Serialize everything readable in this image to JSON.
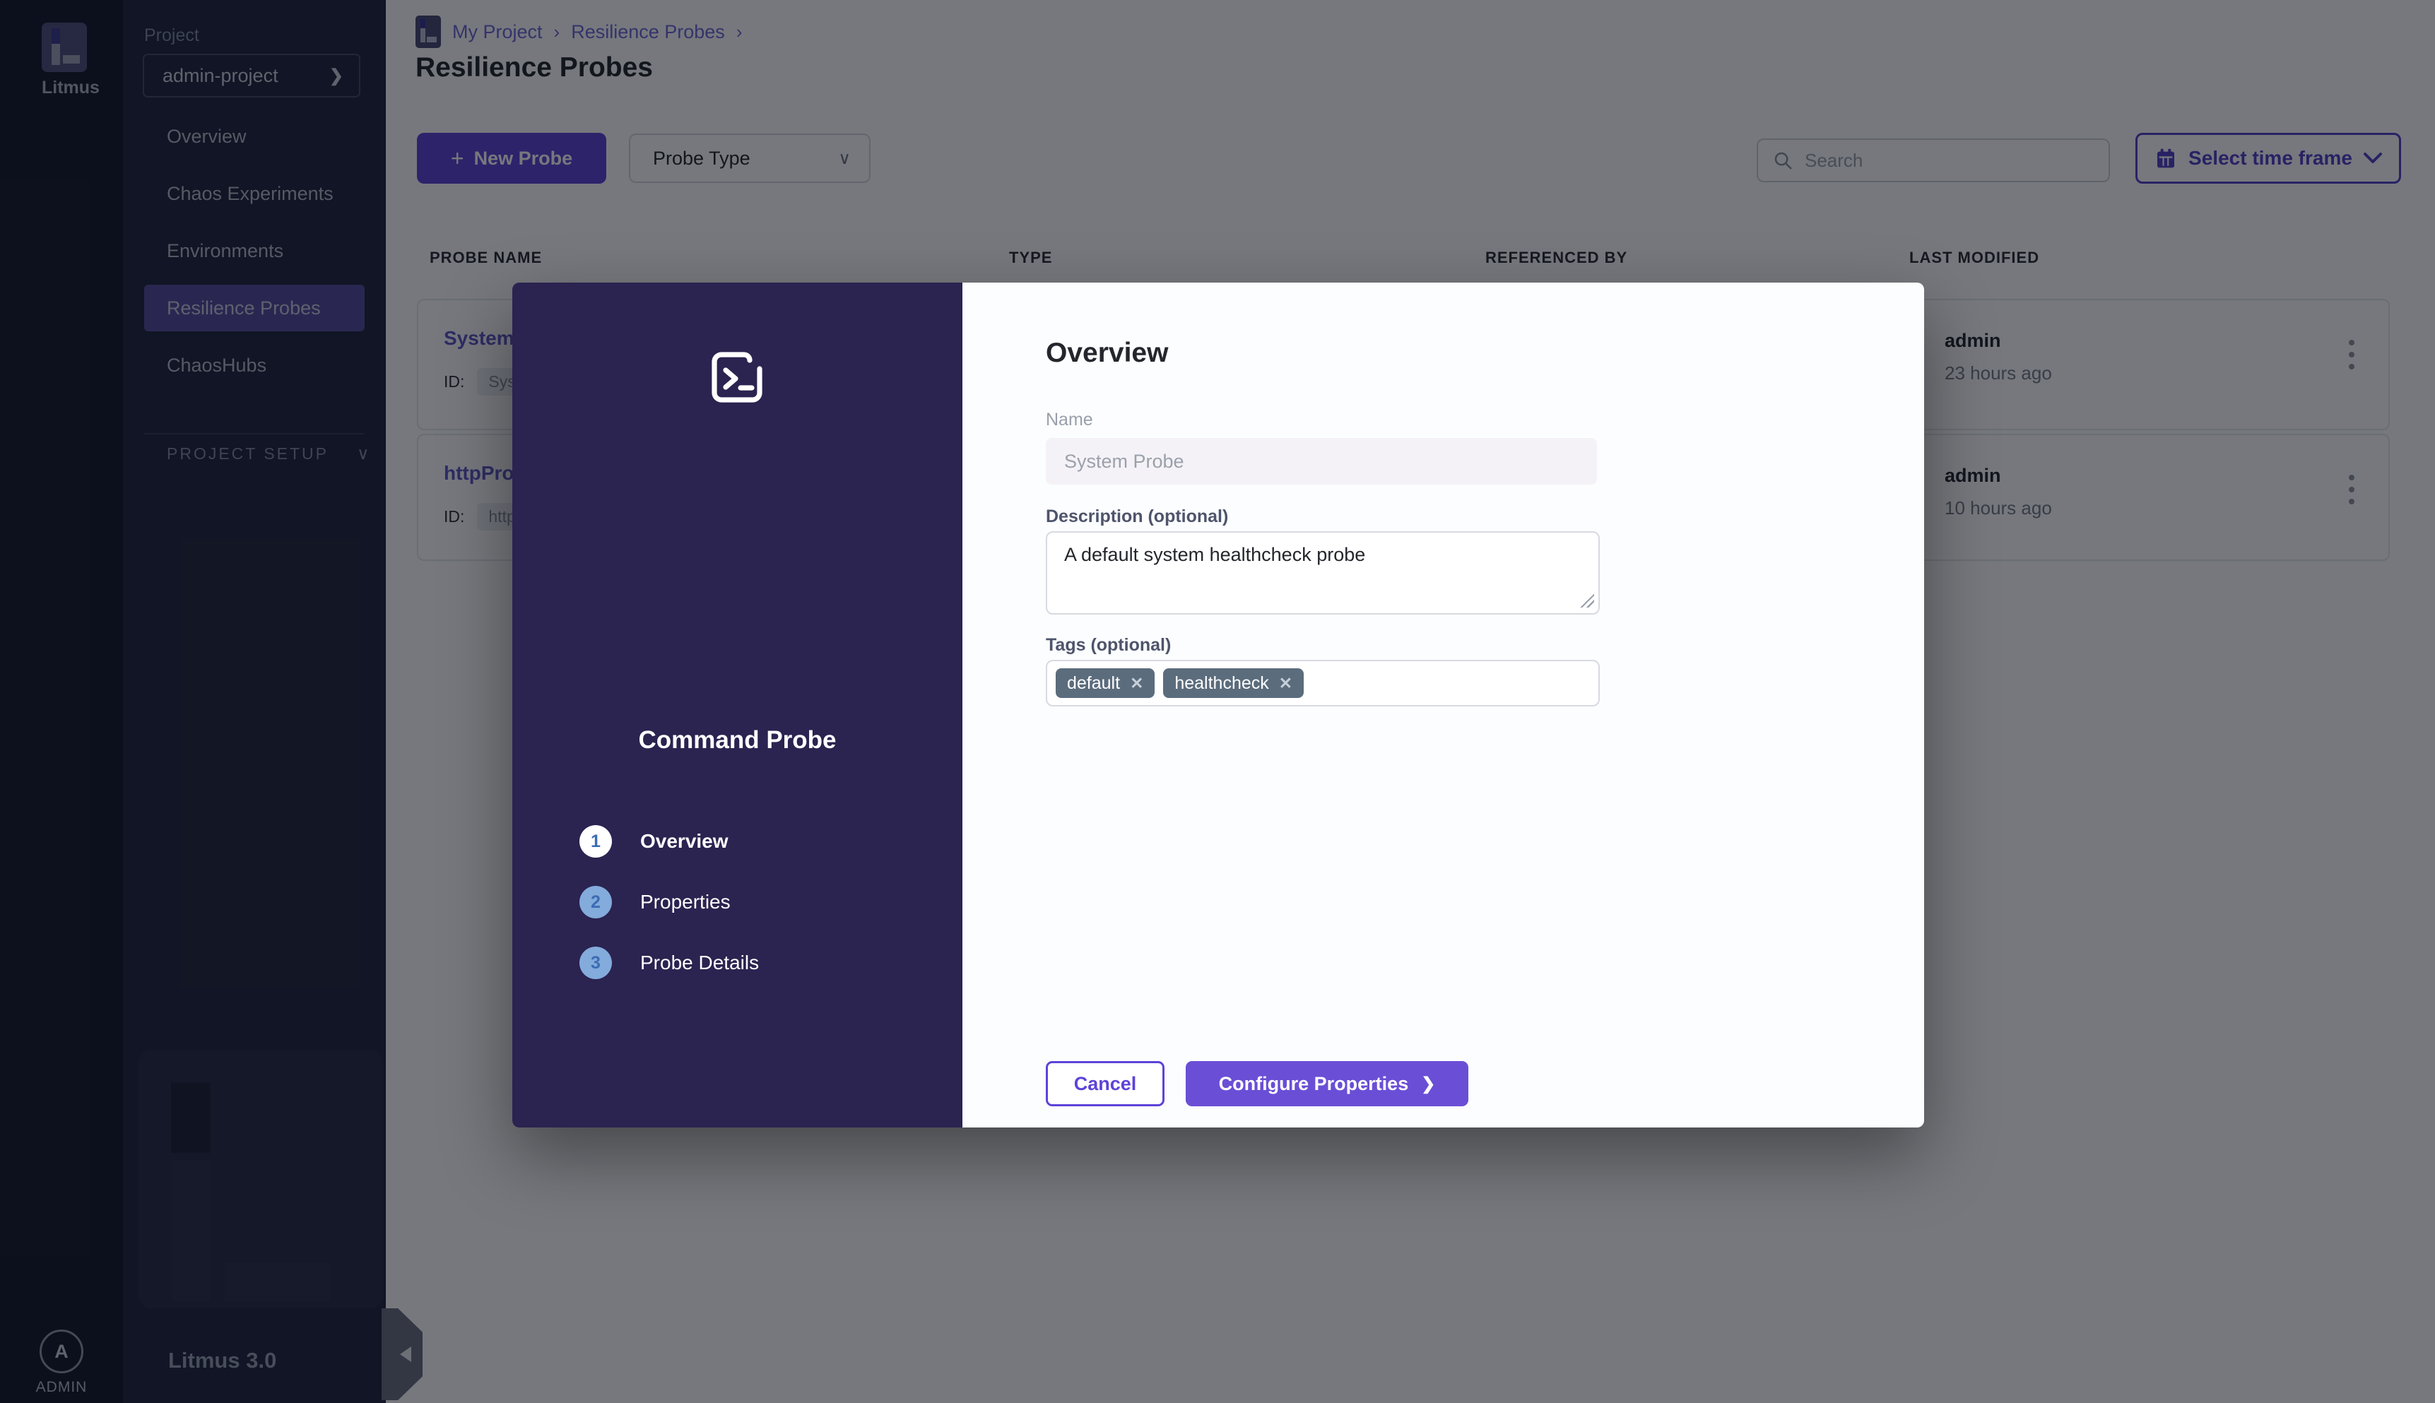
{
  "colors": {
    "primary_purple": "#5d43d8",
    "modal_button_purple": "#6a4ed6",
    "wizard_panel": "#2b2350",
    "sidebar_bg": "#20253c",
    "rail_bg": "#161a2c",
    "active_nav_bg": "#554c9e",
    "link_purple": "#6f66d8",
    "chip_slate": "#5b6c7d"
  },
  "icons": {
    "plus": "+",
    "chevron_right": "❯",
    "chevron_down": "∨",
    "breadcrumb_sep": "›",
    "close": "✕"
  },
  "rail": {
    "logo_text": "Litmus",
    "avatar_letter": "A",
    "admin_label": "ADMIN"
  },
  "sidebar": {
    "project_label": "Project",
    "project_value": "admin-project",
    "items": [
      {
        "label": "Overview"
      },
      {
        "label": "Chaos Experiments"
      },
      {
        "label": "Environments"
      },
      {
        "label": "Resilience Probes"
      },
      {
        "label": "ChaosHubs"
      }
    ],
    "project_setup_label": "PROJECT SETUP",
    "version": "Litmus 3.0"
  },
  "header": {
    "breadcrumb": [
      "My Project",
      "Resilience Probes"
    ],
    "title": "Resilience Probes"
  },
  "toolbar": {
    "new_probe_label": "New Probe",
    "probe_type_label": "Probe Type",
    "search_placeholder": "Search",
    "time_frame_label": "Select time frame"
  },
  "table": {
    "headers": [
      "PROBE NAME",
      "TYPE",
      "REFERENCED BY",
      "LAST MODIFIED"
    ],
    "rows": [
      {
        "name": "System",
        "id_label": "ID:",
        "id_value": "Syst",
        "modified_by": "admin",
        "last_modified": "23 hours ago"
      },
      {
        "name": "httpPro",
        "id_label": "ID:",
        "id_value": "http",
        "modified_by": "admin",
        "last_modified": "10 hours ago"
      }
    ]
  },
  "modal": {
    "wizard_title": "Command Probe",
    "steps": [
      {
        "number": "1",
        "label": "Overview"
      },
      {
        "number": "2",
        "label": "Properties"
      },
      {
        "number": "3",
        "label": "Probe Details"
      }
    ],
    "heading": "Overview",
    "name_label": "Name",
    "name_value": "System Probe",
    "description_label": "Description (optional)",
    "description_value": "A default system healthcheck probe",
    "tags_label": "Tags (optional)",
    "tags": [
      "default",
      "healthcheck"
    ],
    "cancel_label": "Cancel",
    "configure_label": "Configure Properties"
  }
}
